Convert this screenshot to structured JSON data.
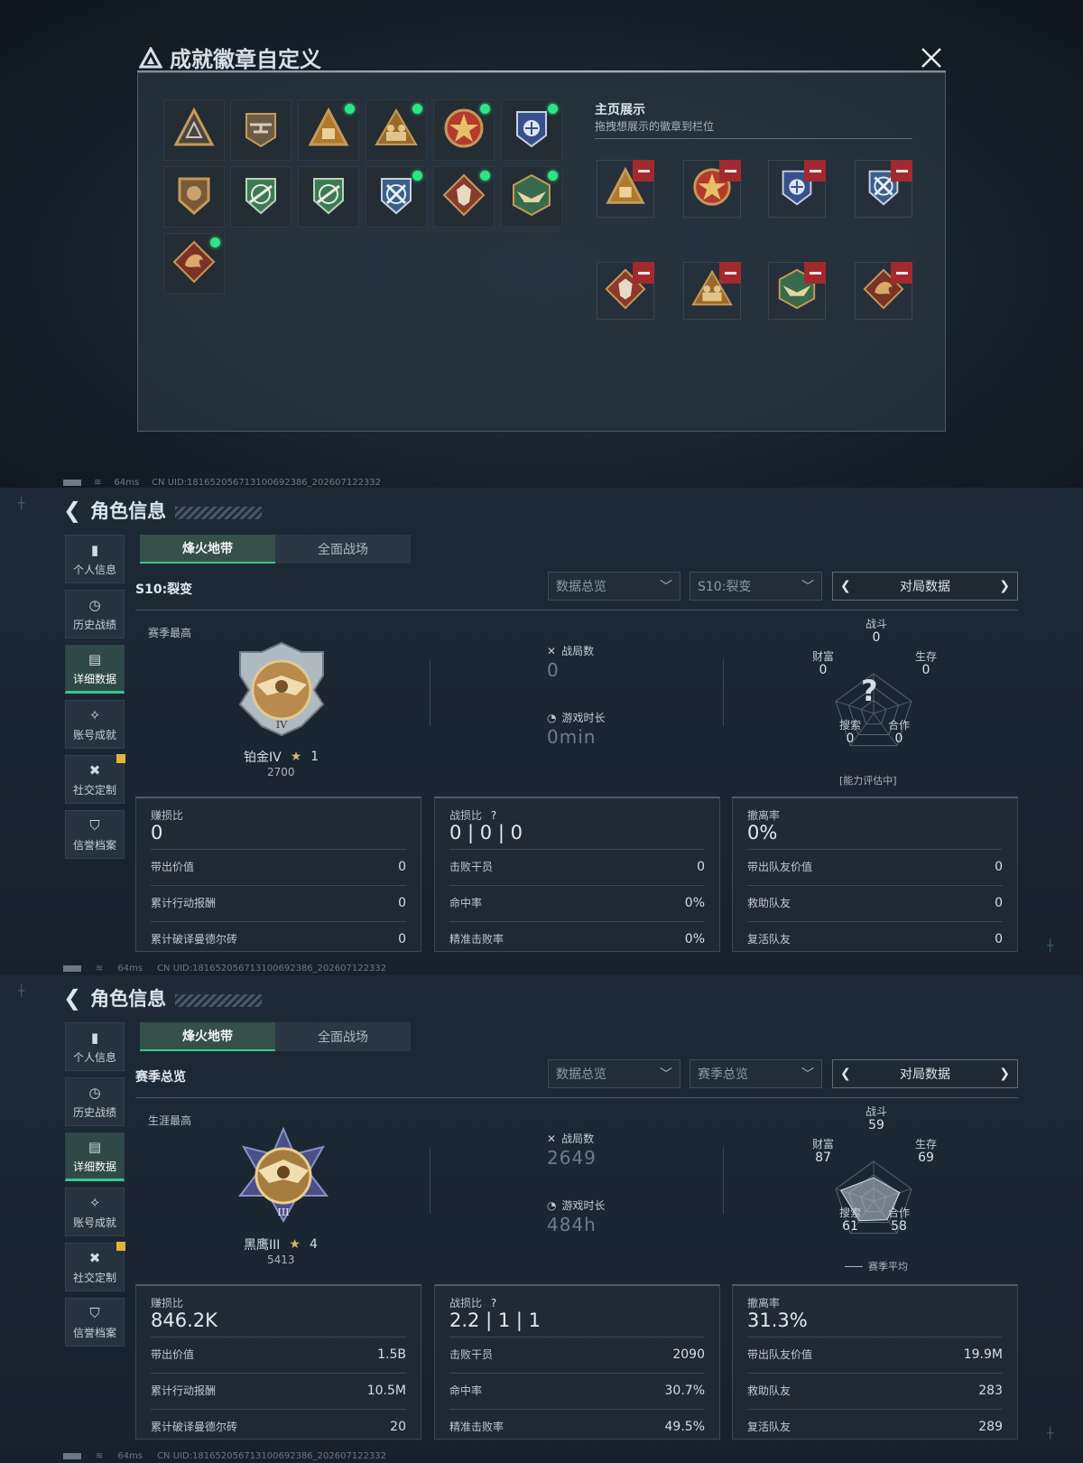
{
  "dialog": {
    "title": "成就徽章自定义",
    "showcase_title": "主页展示",
    "showcase_subtitle": "拖拽想展示的徽章到栏位",
    "close_icon": "close-icon",
    "badges": [
      {
        "name": "triangle-emblem-badge",
        "dot": false
      },
      {
        "name": "helicopter-badge",
        "dot": false
      },
      {
        "name": "triangle-58-badge",
        "dot": true
      },
      {
        "name": "soldiers-badge",
        "dot": true
      },
      {
        "name": "star-medal-badge",
        "dot": true
      },
      {
        "name": "police-shield-badge",
        "dot": true
      },
      {
        "name": "bronze-shield-badge",
        "dot": false
      },
      {
        "name": "green-rifle-shield-badge",
        "dot": false
      },
      {
        "name": "green-rifle-shield-badge-2",
        "dot": false
      },
      {
        "name": "blue-cross-shield-badge",
        "dot": true
      },
      {
        "name": "wolf-diamond-badge",
        "dot": true
      },
      {
        "name": "green-eagle-hex-badge",
        "dot": true
      },
      {
        "name": "dragon-diamond-badge",
        "dot": true
      }
    ],
    "slots": [
      "triangle-58-badge",
      "star-medal-badge",
      "police-shield-badge",
      "blue-cross-shield-badge",
      "wolf-diamond-badge",
      "soldiers-badge",
      "green-eagle-hex-badge",
      "dragon-diamond-badge"
    ]
  },
  "status": {
    "ping": "64ms",
    "uid": "CN UID:18165205671310069238​6_202607122332"
  },
  "nav": {
    "title": "角色信息",
    "items": [
      "个人信息",
      "历史战绩",
      "详细数据",
      "账号成就",
      "社交定制",
      "信誉档案"
    ],
    "tabs": [
      "烽火地带",
      "全面战场"
    ]
  },
  "profiles": [
    {
      "season": "S10:裂变",
      "filter1": "数据总览",
      "filter2": "S10:裂变",
      "mode": "对局数据",
      "rank_label": "赛季最高",
      "rank_name": "铂金IV",
      "stars": "1",
      "points": "2700",
      "matches_label": "战局数",
      "matches": "0",
      "time_label": "游戏时长",
      "time": "0min",
      "radar": {
        "combat": "0",
        "survival": "0",
        "coop": "0",
        "search": "0",
        "wealth": "0",
        "note": "[能力评估中]",
        "labels": [
          "战斗",
          "生存",
          "合作",
          "搜索",
          "财富"
        ],
        "scores": [
          0,
          0,
          0,
          0,
          0
        ],
        "unknown": "?"
      },
      "stats": [
        {
          "label": "赚损比",
          "big": "0",
          "rows": [
            [
              "带出价值",
              "0"
            ],
            [
              "累计行动报酬",
              "0"
            ],
            [
              "累计破译曼德尔砖",
              "0"
            ]
          ]
        },
        {
          "label": "战损比",
          "big": "0 | 0 | 0",
          "rows": [
            [
              "击败干员",
              "0"
            ],
            [
              "命中率",
              "0%"
            ],
            [
              "精准击败率",
              "0%"
            ]
          ]
        },
        {
          "label": "撤离率",
          "big": "0%",
          "rows": [
            [
              "带出队友价值",
              "0"
            ],
            [
              "救助队友",
              "0"
            ],
            [
              "复活队友",
              "0"
            ]
          ]
        }
      ]
    },
    {
      "season": "赛季总览",
      "filter1": "数据总览",
      "filter2": "赛季总览",
      "mode": "对局数据",
      "rank_label": "生涯最高",
      "rank_name": "黑鹰III",
      "stars": "4",
      "points": "5413",
      "matches_label": "战局数",
      "matches": "2649",
      "time_label": "游戏时长",
      "time": "484h",
      "radar": {
        "combat": "59",
        "survival": "69",
        "coop": "58",
        "search": "61",
        "wealth": "87",
        "note": "赛季平均",
        "labels": [
          "战斗",
          "生存",
          "合作",
          "搜索",
          "财富"
        ],
        "scores": [
          59,
          69,
          58,
          61,
          87
        ],
        "unknown": ""
      },
      "stats": [
        {
          "label": "赚损比",
          "big": "846.2K",
          "rows": [
            [
              "带出价值",
              "1.5B"
            ],
            [
              "累计行动报酬",
              "10.5M"
            ],
            [
              "累计破译曼德尔砖",
              "20"
            ]
          ]
        },
        {
          "label": "战损比",
          "big": "2.2 | 1 | 1",
          "rows": [
            [
              "击败干员",
              "2090"
            ],
            [
              "命中率",
              "30.7%"
            ],
            [
              "精准击败率",
              "49.5%"
            ]
          ]
        },
        {
          "label": "撤离率",
          "big": "31.3%",
          "rows": [
            [
              "带出队友价值",
              "19.9M"
            ],
            [
              "救助队友",
              "283"
            ],
            [
              "复活队友",
              "289"
            ]
          ]
        }
      ]
    }
  ],
  "colors": {
    "accent": "#35c98a",
    "dot": "#2ee586",
    "remove": "#a22a2e",
    "gold": "#d8b46a"
  }
}
